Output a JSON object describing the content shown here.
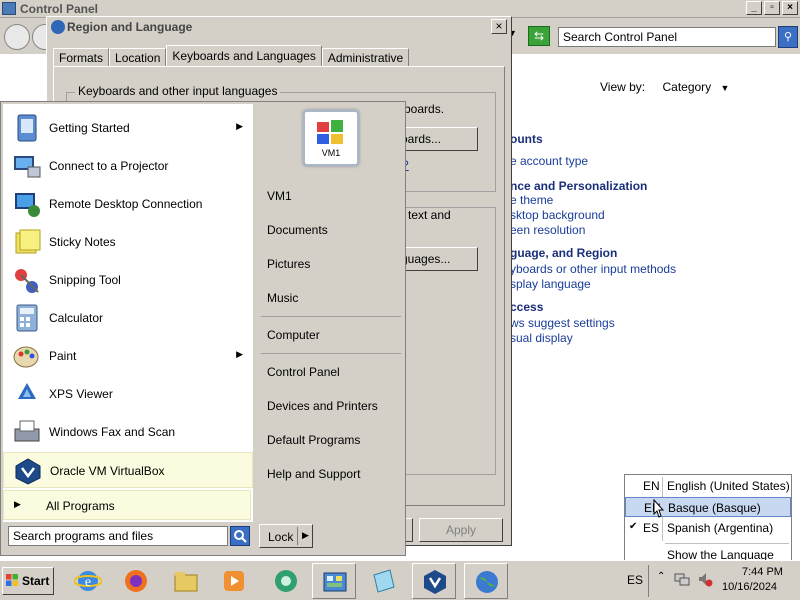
{
  "control_panel": {
    "title": "Control Panel",
    "caption_buttons": [
      "_",
      "▫",
      "×"
    ],
    "search_placeholder": "Search Control Panel",
    "view_by_label": "View by:",
    "view_by_value": "Category",
    "sections": [
      {
        "heading": "ounts",
        "links": [
          "e account type"
        ]
      },
      {
        "heading": "nce and Personalization",
        "links": [
          "e theme",
          "sktop background",
          "een resolution"
        ]
      },
      {
        "heading": "guage, and Region",
        "links": [
          "yboards or other input methods",
          "splay language"
        ]
      },
      {
        "heading": "ccess",
        "links": [
          "ws suggest settings",
          "sual display"
        ]
      }
    ]
  },
  "dialog": {
    "title": "Region and Language",
    "close_label": "×",
    "tabs": [
      "Formats",
      "Location",
      "Keyboards and Languages",
      "Administrative"
    ],
    "active_tab": "Keyboards and Languages",
    "group1_legend": "Keyboards and other input languages",
    "group1_text_fragment": "boards.",
    "change_keyboards_fragment": "oards...",
    "help_link_fragment": "?",
    "group2_text_fragment": "text and",
    "install_languages_fragment": "guages...",
    "apply_label": "Apply"
  },
  "start_menu": {
    "programs": [
      {
        "label": "Getting Started",
        "icon": "getting-started-icon",
        "submenu": true
      },
      {
        "label": "Connect to a Projector",
        "icon": "projector-icon",
        "submenu": false
      },
      {
        "label": "Remote Desktop Connection",
        "icon": "remote-desktop-icon",
        "submenu": false
      },
      {
        "label": "Sticky Notes",
        "icon": "sticky-notes-icon",
        "submenu": false
      },
      {
        "label": "Snipping Tool",
        "icon": "scissors-icon",
        "submenu": false
      },
      {
        "label": "Calculator",
        "icon": "calculator-icon",
        "submenu": false
      },
      {
        "label": "Paint",
        "icon": "paint-icon",
        "submenu": true
      },
      {
        "label": "XPS Viewer",
        "icon": "xps-viewer-icon",
        "submenu": false
      },
      {
        "label": "Windows Fax and Scan",
        "icon": "fax-icon",
        "submenu": false
      },
      {
        "label": "Oracle VM VirtualBox",
        "icon": "virtualbox-icon",
        "submenu": false
      }
    ],
    "all_programs_label": "All Programs",
    "search_placeholder": "Search programs and files",
    "user_name": "VM1",
    "right_items": [
      "Documents",
      "Pictures",
      "Music",
      "Computer",
      "Control Panel",
      "Devices and Printers",
      "Default Programs",
      "Help and Support"
    ],
    "lock_label": "Lock"
  },
  "language_popup": {
    "languages": [
      {
        "code": "EN",
        "name": "English (United States)",
        "checked": false
      },
      {
        "code": "EN",
        "name": "Basque (Basque)",
        "checked": false
      },
      {
        "code": "ES",
        "name": "Spanish (Argentina)",
        "checked": true
      }
    ],
    "show_bar_label": "Show the Language bar"
  },
  "taskbar": {
    "start_label": "Start",
    "pinned": [
      "internet-explorer-icon",
      "firefox-icon",
      "file-explorer-icon",
      "media-player-icon",
      "network-icon",
      "control-panel-icon",
      "notepad-icon",
      "virtualbox-icon",
      "globe-icon"
    ],
    "tray_language": "ES",
    "time": "7:44 PM",
    "date": "10/16/2024"
  }
}
